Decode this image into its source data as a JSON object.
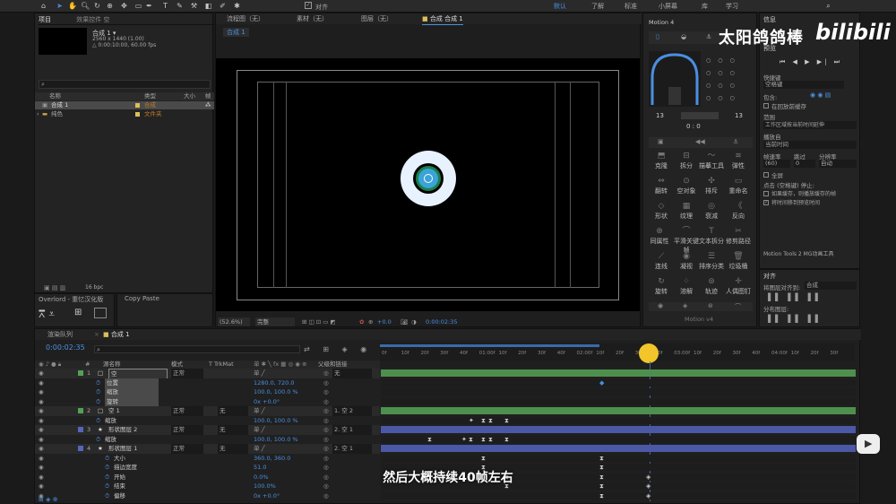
{
  "toolbar": {
    "snap_label": "对齐",
    "workspaces": [
      "默认",
      "了解",
      "标准",
      "小屏幕",
      "库",
      "学习"
    ]
  },
  "project": {
    "tab": "项目",
    "effects_tab": "效果控件 空",
    "comp_name": "合成 1 ▾",
    "comp_size": "2560 x 1440 (1.00)",
    "comp_duration": "△ 0:00:10:00, 60.00 fps",
    "search_icon": "search-icon",
    "columns": [
      "名称",
      "类型",
      "大小",
      "帧"
    ],
    "items": [
      {
        "name": "合成 1",
        "type": "合成"
      },
      {
        "name": "纯色",
        "type": "文件夹"
      }
    ],
    "bpc": "16 bpc"
  },
  "overlord": {
    "tab": "Overlord - 重忆汉化版"
  },
  "copypaste": {
    "tab": "Copy Paste"
  },
  "viewer": {
    "tabs": [
      "合成 合成 1",
      "图层（无）",
      "素材（无）",
      "流程图（无）"
    ],
    "sub_tab": "合成 1",
    "zoom": "(52.6%)",
    "quality": "完整",
    "exposure": "+0.0",
    "timecode": "0:00:02:35"
  },
  "motion": {
    "title": "Motion 4",
    "left_value": "13",
    "right_value": "13",
    "counter": "0 : 0",
    "footer": "Motion v4",
    "buttons": [
      "克隆",
      "拆分",
      "描摹工具",
      "弹性",
      "翻转",
      "空对象",
      "排斥",
      "重命名",
      "形状",
      "纹理",
      "衰减",
      "反向",
      "同属性",
      "平滑关键帧",
      "文本拆分",
      "修剪路径",
      "连线",
      "凝视",
      "排序分类",
      "垃圾桶",
      "旋转",
      "溶解",
      "轨迹",
      "人偶图钉"
    ]
  },
  "info": {
    "tab": "信息",
    "preview_tab": "预览",
    "shortcut_label": "快捷键",
    "shortcut_value": "空格键",
    "include_label": "包含:",
    "cache_label": "在回放前缓存",
    "range_label": "范围",
    "range_value": "工作区域按当前时间延伸",
    "play_from_label": "播放自",
    "play_from_value": "当前时间",
    "fps_label": "帧速率",
    "skip_label": "跳过",
    "resolution_label": "分辨率",
    "fps_value": "(60)",
    "skip_value": "0",
    "resolution_value": "自动",
    "fullscreen_label": "全屏",
    "stop_label": "点击 (空格键) 停止:",
    "opt1": "如果缓存，则播放缓存的帧",
    "opt2": "将时间移到预览时间",
    "mg_tools": "Motion Tools 2 MG动画工具"
  },
  "align": {
    "tab": "对齐",
    "align_to_label": "将图层对齐到:",
    "align_to_value": "合成",
    "distribute_label": "分布图层:"
  },
  "timeline": {
    "tabs": [
      "渲染队列",
      "合成 1"
    ],
    "timecode": "0:00:02:35",
    "col_headers": [
      "源名称",
      "模式",
      "T TrkMat",
      "父级和链接"
    ],
    "ruler": [
      "0f",
      "10f",
      "20f",
      "30f",
      "40f",
      "01:00f",
      "10f",
      "20f",
      "30f",
      "40f",
      "02:00f",
      "10f",
      "20f",
      "30f",
      "40f",
      "03:00f",
      "10f",
      "20f",
      "30f",
      "40f",
      "04:00f",
      "10f",
      "20f",
      "30f"
    ],
    "layers": [
      {
        "num": "1",
        "name": "空",
        "mode": "正常",
        "trk": "",
        "parent": "无",
        "indent": 0,
        "color": "#55a055",
        "type": "layer"
      },
      {
        "num": "",
        "name": "位置",
        "mode": "",
        "trk": "",
        "parent": "",
        "value": "1280.0, 720.0",
        "indent": 2,
        "type": "prop"
      },
      {
        "num": "",
        "name": "缩放",
        "mode": "",
        "trk": "",
        "parent": "",
        "value": "100.0, 100.0 %",
        "indent": 2,
        "type": "prop"
      },
      {
        "num": "",
        "name": "旋转",
        "mode": "",
        "trk": "",
        "parent": "",
        "value": "0x +0.0°",
        "indent": 2,
        "type": "prop"
      },
      {
        "num": "2",
        "name": "空 1",
        "mode": "正常",
        "trk": "无",
        "parent": "1. 空 2",
        "indent": 0,
        "color": "#55a055",
        "type": "layer"
      },
      {
        "num": "",
        "name": "缩放",
        "mode": "",
        "trk": "",
        "parent": "",
        "value": "100.0, 100.0 %",
        "indent": 2,
        "type": "prop"
      },
      {
        "num": "3",
        "name": "形状图层 2",
        "mode": "正常",
        "trk": "无",
        "parent": "2. 空 1",
        "indent": 0,
        "color": "#5566bb",
        "type": "layer"
      },
      {
        "num": "",
        "name": "缩放",
        "mode": "",
        "trk": "",
        "parent": "",
        "value": "100.0, 100.0 %",
        "indent": 2,
        "type": "prop"
      },
      {
        "num": "4",
        "name": "形状图层 1",
        "mode": "正常",
        "trk": "无",
        "parent": "2. 空 1",
        "indent": 0,
        "color": "#5566bb",
        "type": "layer"
      },
      {
        "num": "",
        "name": "大小",
        "mode": "",
        "trk": "",
        "parent": "",
        "value": "360.0, 360.0",
        "indent": 3,
        "type": "prop"
      },
      {
        "num": "",
        "name": "描边宽度",
        "mode": "",
        "trk": "",
        "parent": "",
        "value": "51.0",
        "indent": 3,
        "type": "prop"
      },
      {
        "num": "",
        "name": "开始",
        "mode": "",
        "trk": "",
        "parent": "",
        "value": "0.0%",
        "indent": 3,
        "type": "prop"
      },
      {
        "num": "",
        "name": "结束",
        "mode": "",
        "trk": "",
        "parent": "",
        "value": "100.0%",
        "indent": 3,
        "type": "prop"
      },
      {
        "num": "",
        "name": "偏移",
        "mode": "",
        "trk": "",
        "parent": "",
        "value": "0x +0.0°",
        "indent": 3,
        "type": "prop"
      }
    ]
  },
  "watermark": {
    "uploader": "太阳鸽鸽棒",
    "logo": "bilibili"
  },
  "subtitle": "然后大概持续40帧左右"
}
